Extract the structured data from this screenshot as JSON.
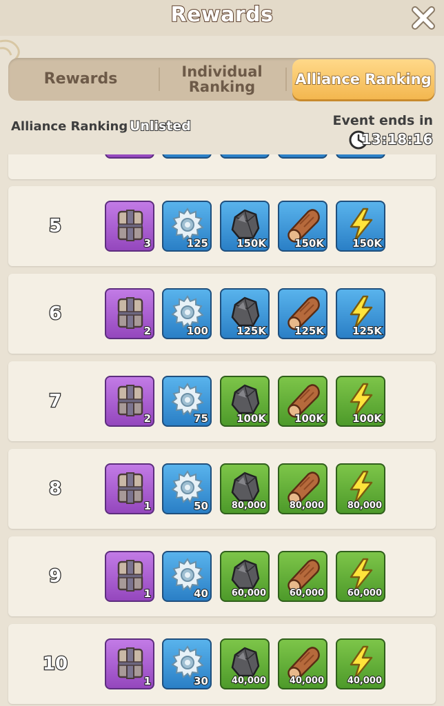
{
  "header": {
    "title": "Rewards"
  },
  "tabs": [
    {
      "label": "Rewards",
      "active": false
    },
    {
      "label": "Individual Ranking",
      "active": false
    },
    {
      "label": "Alliance Ranking",
      "active": true
    }
  ],
  "status": {
    "alliance_ranking_label": "Alliance Ranking",
    "alliance_ranking_value": "Unlisted",
    "event_ends_label": "Event ends in",
    "timer": "13:18:16"
  },
  "colors": {
    "purple": "#9447bd",
    "blue": "#2a7fc6",
    "green": "#4d9a2a",
    "tab_active": "#f3b74f"
  },
  "rows": [
    {
      "rank": "5",
      "rewards": [
        {
          "icon": "chest-icon",
          "tile": "purple",
          "qty": "3"
        },
        {
          "icon": "gear-icon",
          "tile": "blue",
          "qty": "125"
        },
        {
          "icon": "stone-icon",
          "tile": "blue",
          "qty": "150K"
        },
        {
          "icon": "wood-icon",
          "tile": "blue",
          "qty": "150K"
        },
        {
          "icon": "lightning-icon",
          "tile": "blue",
          "qty": "150K"
        }
      ]
    },
    {
      "rank": "6",
      "rewards": [
        {
          "icon": "chest-icon",
          "tile": "purple",
          "qty": "2"
        },
        {
          "icon": "gear-icon",
          "tile": "blue",
          "qty": "100"
        },
        {
          "icon": "stone-icon",
          "tile": "blue",
          "qty": "125K"
        },
        {
          "icon": "wood-icon",
          "tile": "blue",
          "qty": "125K"
        },
        {
          "icon": "lightning-icon",
          "tile": "blue",
          "qty": "125K"
        }
      ]
    },
    {
      "rank": "7",
      "rewards": [
        {
          "icon": "chest-icon",
          "tile": "purple",
          "qty": "2"
        },
        {
          "icon": "gear-icon",
          "tile": "blue",
          "qty": "75"
        },
        {
          "icon": "stone-icon",
          "tile": "green",
          "qty": "100K"
        },
        {
          "icon": "wood-icon",
          "tile": "green",
          "qty": "100K"
        },
        {
          "icon": "lightning-icon",
          "tile": "green",
          "qty": "100K"
        }
      ]
    },
    {
      "rank": "8",
      "rewards": [
        {
          "icon": "chest-icon",
          "tile": "purple",
          "qty": "1"
        },
        {
          "icon": "gear-icon",
          "tile": "blue",
          "qty": "50"
        },
        {
          "icon": "stone-icon",
          "tile": "green",
          "qty": "80,000"
        },
        {
          "icon": "wood-icon",
          "tile": "green",
          "qty": "80,000"
        },
        {
          "icon": "lightning-icon",
          "tile": "green",
          "qty": "80,000"
        }
      ]
    },
    {
      "rank": "9",
      "rewards": [
        {
          "icon": "chest-icon",
          "tile": "purple",
          "qty": "1"
        },
        {
          "icon": "gear-icon",
          "tile": "blue",
          "qty": "40"
        },
        {
          "icon": "stone-icon",
          "tile": "green",
          "qty": "60,000"
        },
        {
          "icon": "wood-icon",
          "tile": "green",
          "qty": "60,000"
        },
        {
          "icon": "lightning-icon",
          "tile": "green",
          "qty": "60,000"
        }
      ]
    },
    {
      "rank": "10",
      "rewards": [
        {
          "icon": "chest-icon",
          "tile": "purple",
          "qty": "1"
        },
        {
          "icon": "gear-icon",
          "tile": "blue",
          "qty": "30"
        },
        {
          "icon": "stone-icon",
          "tile": "green",
          "qty": "40,000"
        },
        {
          "icon": "wood-icon",
          "tile": "green",
          "qty": "40,000"
        },
        {
          "icon": "lightning-icon",
          "tile": "green",
          "qty": "40,000"
        }
      ]
    }
  ]
}
